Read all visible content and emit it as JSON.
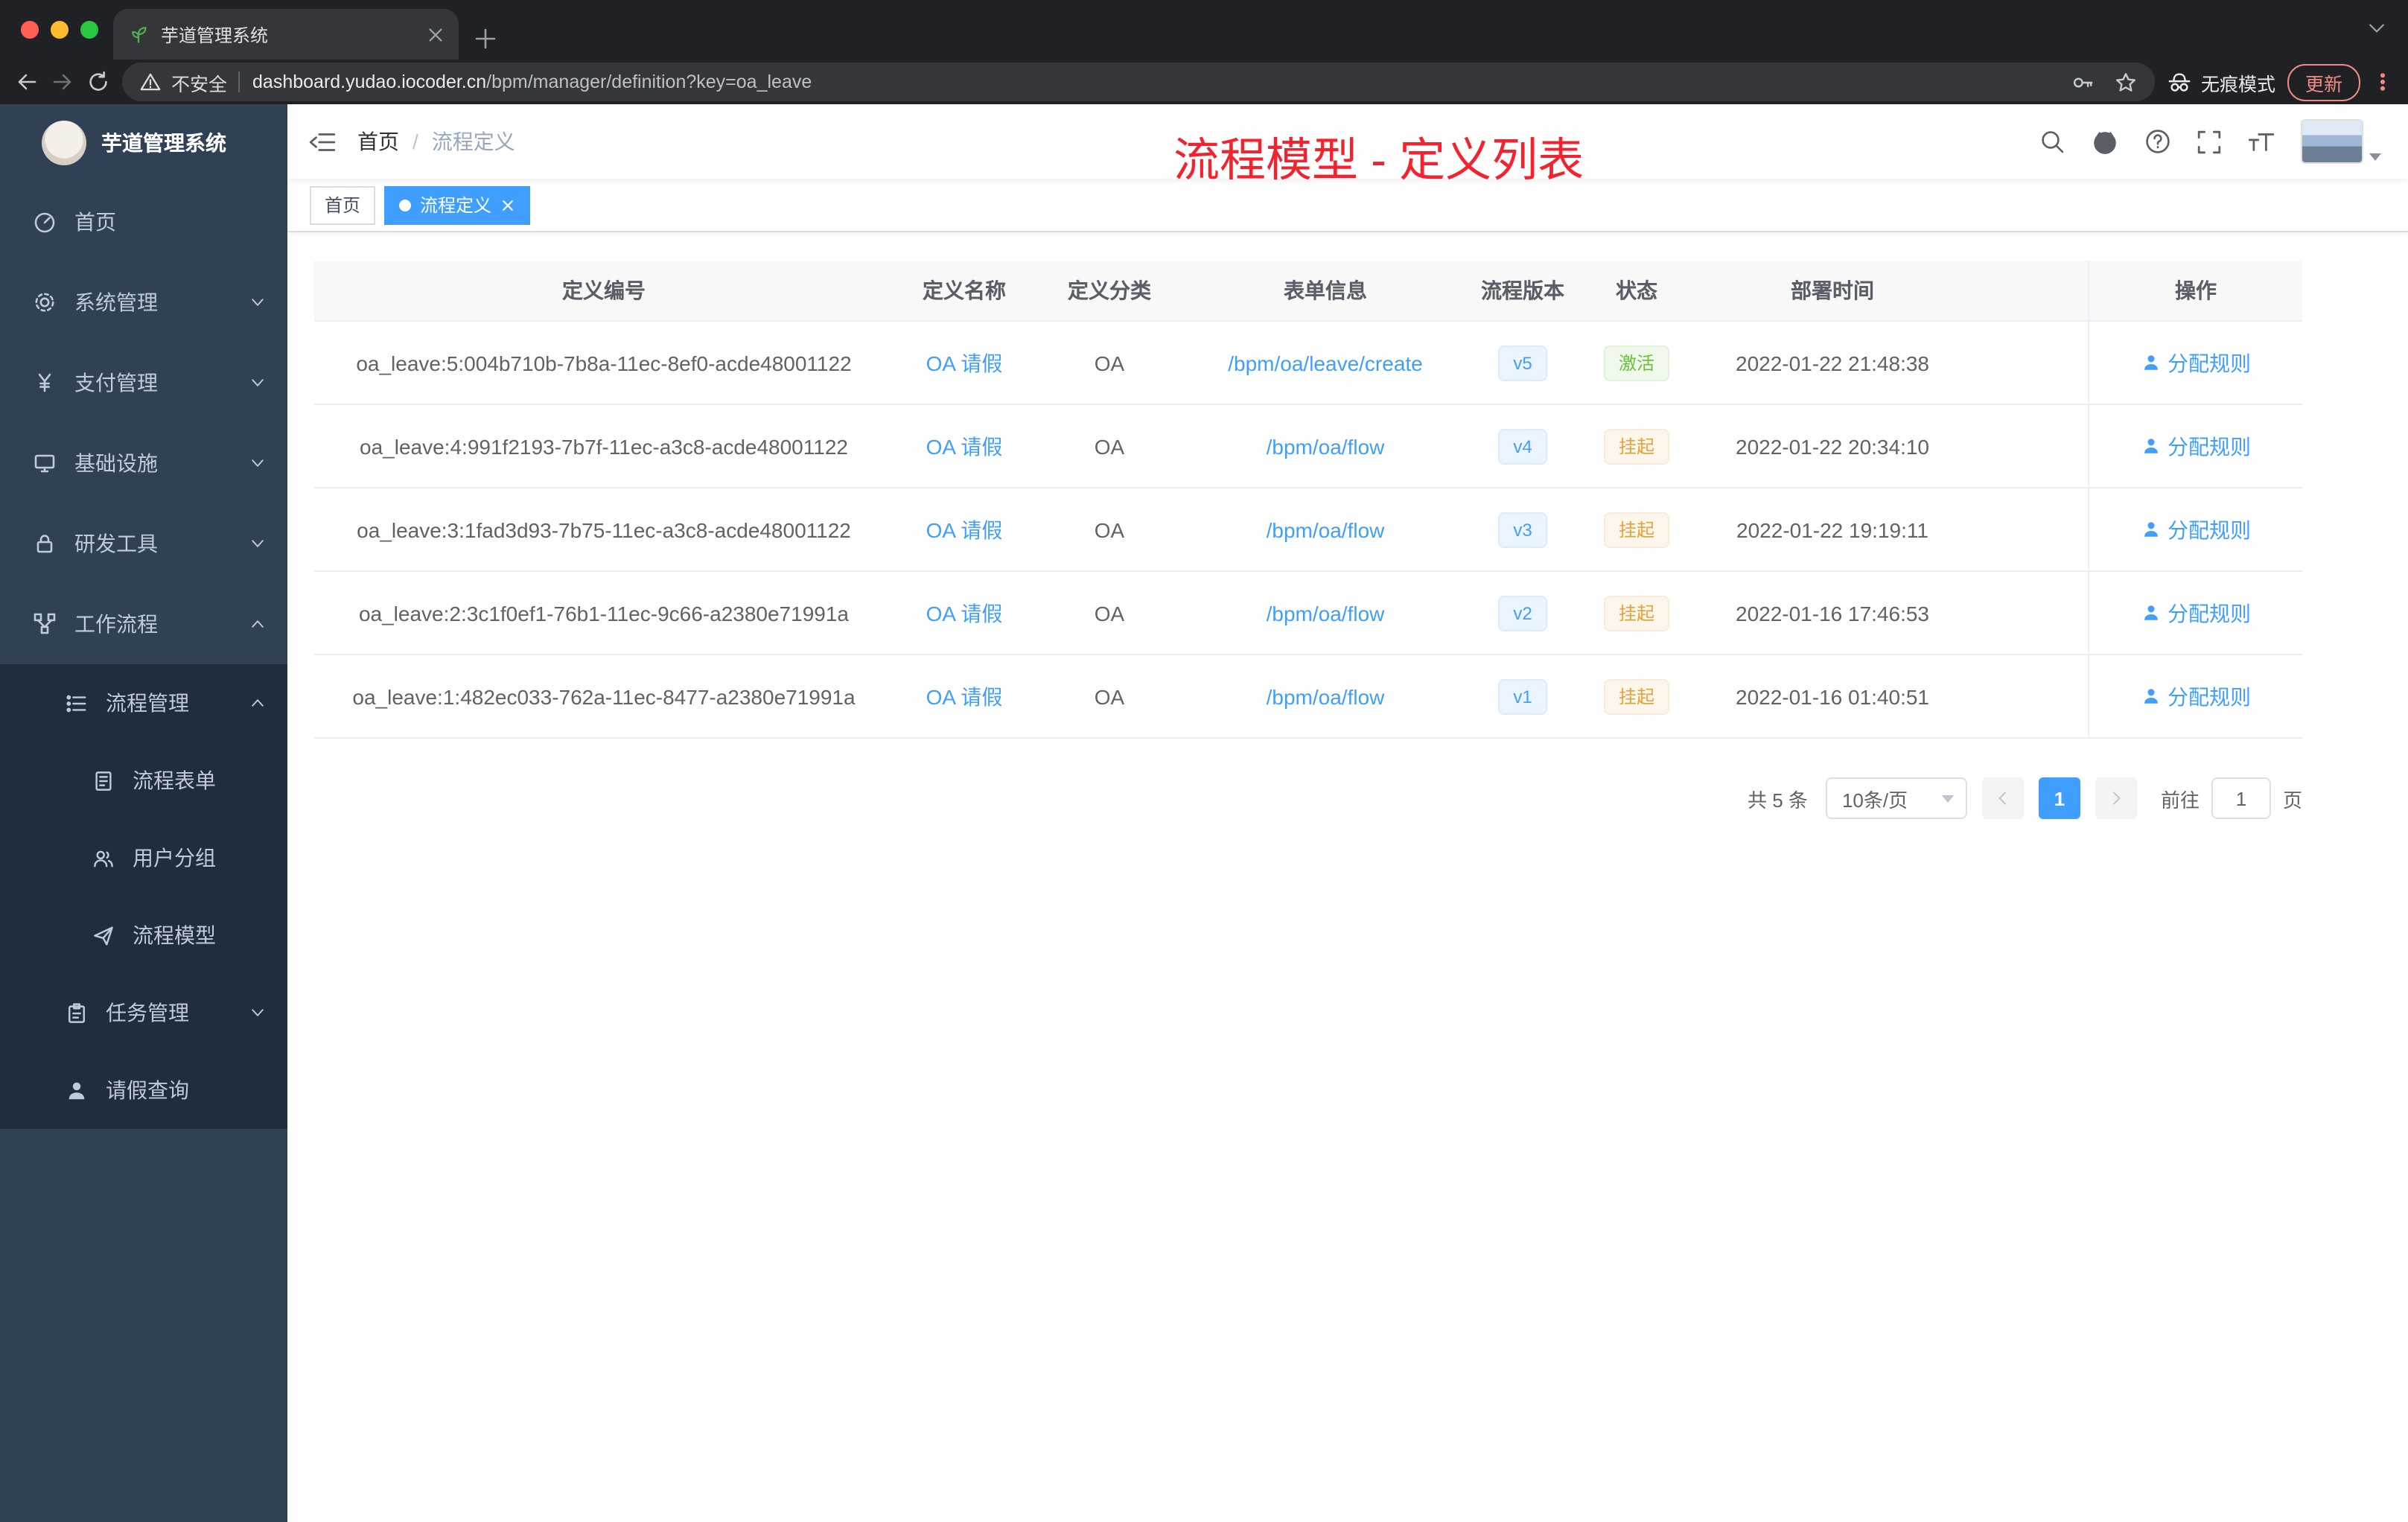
{
  "browser": {
    "tab_title": "芋道管理系统",
    "security_label": "不安全",
    "url_host": "dashboard.yudao.iocoder.cn",
    "url_path": "/bpm/manager/definition?key=oa_leave",
    "incognito_label": "无痕模式",
    "update_label": "更新"
  },
  "sidebar": {
    "logo_title": "芋道管理系统",
    "menu": [
      {
        "label": "首页"
      },
      {
        "label": "系统管理"
      },
      {
        "label": "支付管理"
      },
      {
        "label": "基础设施"
      },
      {
        "label": "研发工具"
      },
      {
        "label": "工作流程"
      },
      {
        "label": "流程管理"
      },
      {
        "label": "流程表单"
      },
      {
        "label": "用户分组"
      },
      {
        "label": "流程模型"
      },
      {
        "label": "任务管理"
      },
      {
        "label": "请假查询"
      }
    ]
  },
  "header": {
    "breadcrumb_home": "首页",
    "breadcrumb_separator": "/",
    "breadcrumb_current": "流程定义",
    "annotation": "流程模型 - 定义列表"
  },
  "tags": {
    "home": "首页",
    "active": "流程定义"
  },
  "table": {
    "headers": [
      "定义编号",
      "定义名称",
      "定义分类",
      "表单信息",
      "流程版本",
      "状态",
      "部署时间",
      "操作"
    ],
    "rows": [
      {
        "id": "oa_leave:5:004b710b-7b8a-11ec-8ef0-acde48001122",
        "name": "OA 请假",
        "category": "OA",
        "form": "/bpm/oa/leave/create",
        "version": "v5",
        "status": "激活",
        "status_type": "success",
        "deploy_time": "2022-01-22 21:48:38",
        "action": "分配规则"
      },
      {
        "id": "oa_leave:4:991f2193-7b7f-11ec-a3c8-acde48001122",
        "name": "OA 请假",
        "category": "OA",
        "form": "/bpm/oa/flow",
        "version": "v4",
        "status": "挂起",
        "status_type": "warning",
        "deploy_time": "2022-01-22 20:34:10",
        "action": "分配规则"
      },
      {
        "id": "oa_leave:3:1fad3d93-7b75-11ec-a3c8-acde48001122",
        "name": "OA 请假",
        "category": "OA",
        "form": "/bpm/oa/flow",
        "version": "v3",
        "status": "挂起",
        "status_type": "warning",
        "deploy_time": "2022-01-22 19:19:11",
        "action": "分配规则"
      },
      {
        "id": "oa_leave:2:3c1f0ef1-76b1-11ec-9c66-a2380e71991a",
        "name": "OA 请假",
        "category": "OA",
        "form": "/bpm/oa/flow",
        "version": "v2",
        "status": "挂起",
        "status_type": "warning",
        "deploy_time": "2022-01-16 17:46:53",
        "action": "分配规则"
      },
      {
        "id": "oa_leave:1:482ec033-762a-11ec-8477-a2380e71991a",
        "name": "OA 请假",
        "category": "OA",
        "form": "/bpm/oa/flow",
        "version": "v1",
        "status": "挂起",
        "status_type": "warning",
        "deploy_time": "2022-01-16 01:40:51",
        "action": "分配规则"
      }
    ]
  },
  "pagination": {
    "total": "共 5 条",
    "page_size": "10条/页",
    "current_page": "1",
    "goto_label": "前往",
    "goto_value": "1",
    "goto_unit": "页"
  },
  "colors": {
    "accent_blue": "#409eff",
    "success_green": "#67c23a",
    "warning_orange": "#e6a23c",
    "annotation_red": "#f5222d",
    "sidebar_bg": "#304156",
    "submenu_bg": "#1f2d3d"
  }
}
